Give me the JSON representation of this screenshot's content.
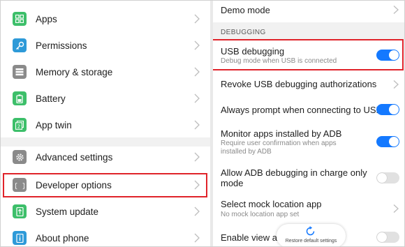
{
  "left_menu": {
    "items": [
      {
        "label": "Apps",
        "icon": "apps-icon",
        "color": "#3dbf6a"
      },
      {
        "label": "Permissions",
        "icon": "key-icon",
        "color": "#2e9ad8"
      },
      {
        "label": "Memory & storage",
        "icon": "storage-icon",
        "color": "#8a8a8a"
      },
      {
        "label": "Battery",
        "icon": "battery-icon",
        "color": "#3dbf6a"
      },
      {
        "label": "App twin",
        "icon": "app-twin-icon",
        "color": "#3dbf6a"
      },
      {
        "label": "Advanced settings",
        "icon": "gear-icon",
        "color": "#8a8a8a"
      },
      {
        "label": "Developer options",
        "icon": "braces-icon",
        "color": "#8a8a8a"
      },
      {
        "label": "System update",
        "icon": "system-update-icon",
        "color": "#3dbf6a"
      },
      {
        "label": "About phone",
        "icon": "info-icon",
        "color": "#2e9ad8"
      }
    ]
  },
  "developer": {
    "demo_mode": "Demo mode",
    "section_debugging": "DEBUGGING",
    "usb_debugging": {
      "title": "USB debugging",
      "subtitle": "Debug mode when USB is connected",
      "on": true
    },
    "revoke": {
      "title": "Revoke USB debugging authorizations"
    },
    "always_prompt": {
      "title": "Always prompt when connecting to USB",
      "on": true
    },
    "monitor_apps": {
      "title": "Monitor apps installed by ADB",
      "subtitle_line1": "Require user confirmation when apps",
      "subtitle_line2": "installed by ADB",
      "on": true
    },
    "allow_adb_charge": {
      "title_line1": "Allow ADB debugging in charge only",
      "title_line2": "mode",
      "on": false
    },
    "mock_location": {
      "title": "Select mock location app",
      "subtitle": "No mock location app set"
    },
    "enable_view": {
      "title": "Enable view att",
      "on": false
    },
    "restore_default": "Restore default settings"
  },
  "colors": {
    "toggle_on": "#1479ff",
    "highlight": "#e0232a"
  }
}
